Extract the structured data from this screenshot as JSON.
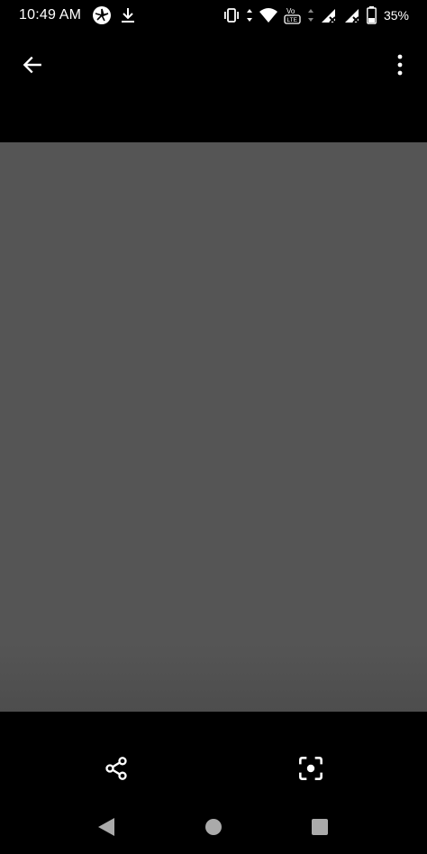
{
  "status_bar": {
    "time": "10:49 AM",
    "battery": "35%",
    "left_icons": [
      "pinwheel-app-icon",
      "download-icon"
    ],
    "right_icons": [
      "vibrate-icon",
      "data-arrows-icon",
      "wifi-icon",
      "volte-icon",
      "data-arrows-icon",
      "signal-no-service-icon",
      "signal-no-service-icon",
      "battery-icon"
    ]
  },
  "app_bar": {
    "back_icon": "arrow-back-icon",
    "menu_icon": "more-vert-icon"
  },
  "viewer": {
    "background_color": "#555555"
  },
  "actions": {
    "share_icon": "share-icon",
    "lens_icon": "lens-icon"
  },
  "nav_bar": {
    "back_icon": "nav-back-triangle-icon",
    "home_icon": "nav-home-circle-icon",
    "recents_icon": "nav-recents-square-icon"
  }
}
